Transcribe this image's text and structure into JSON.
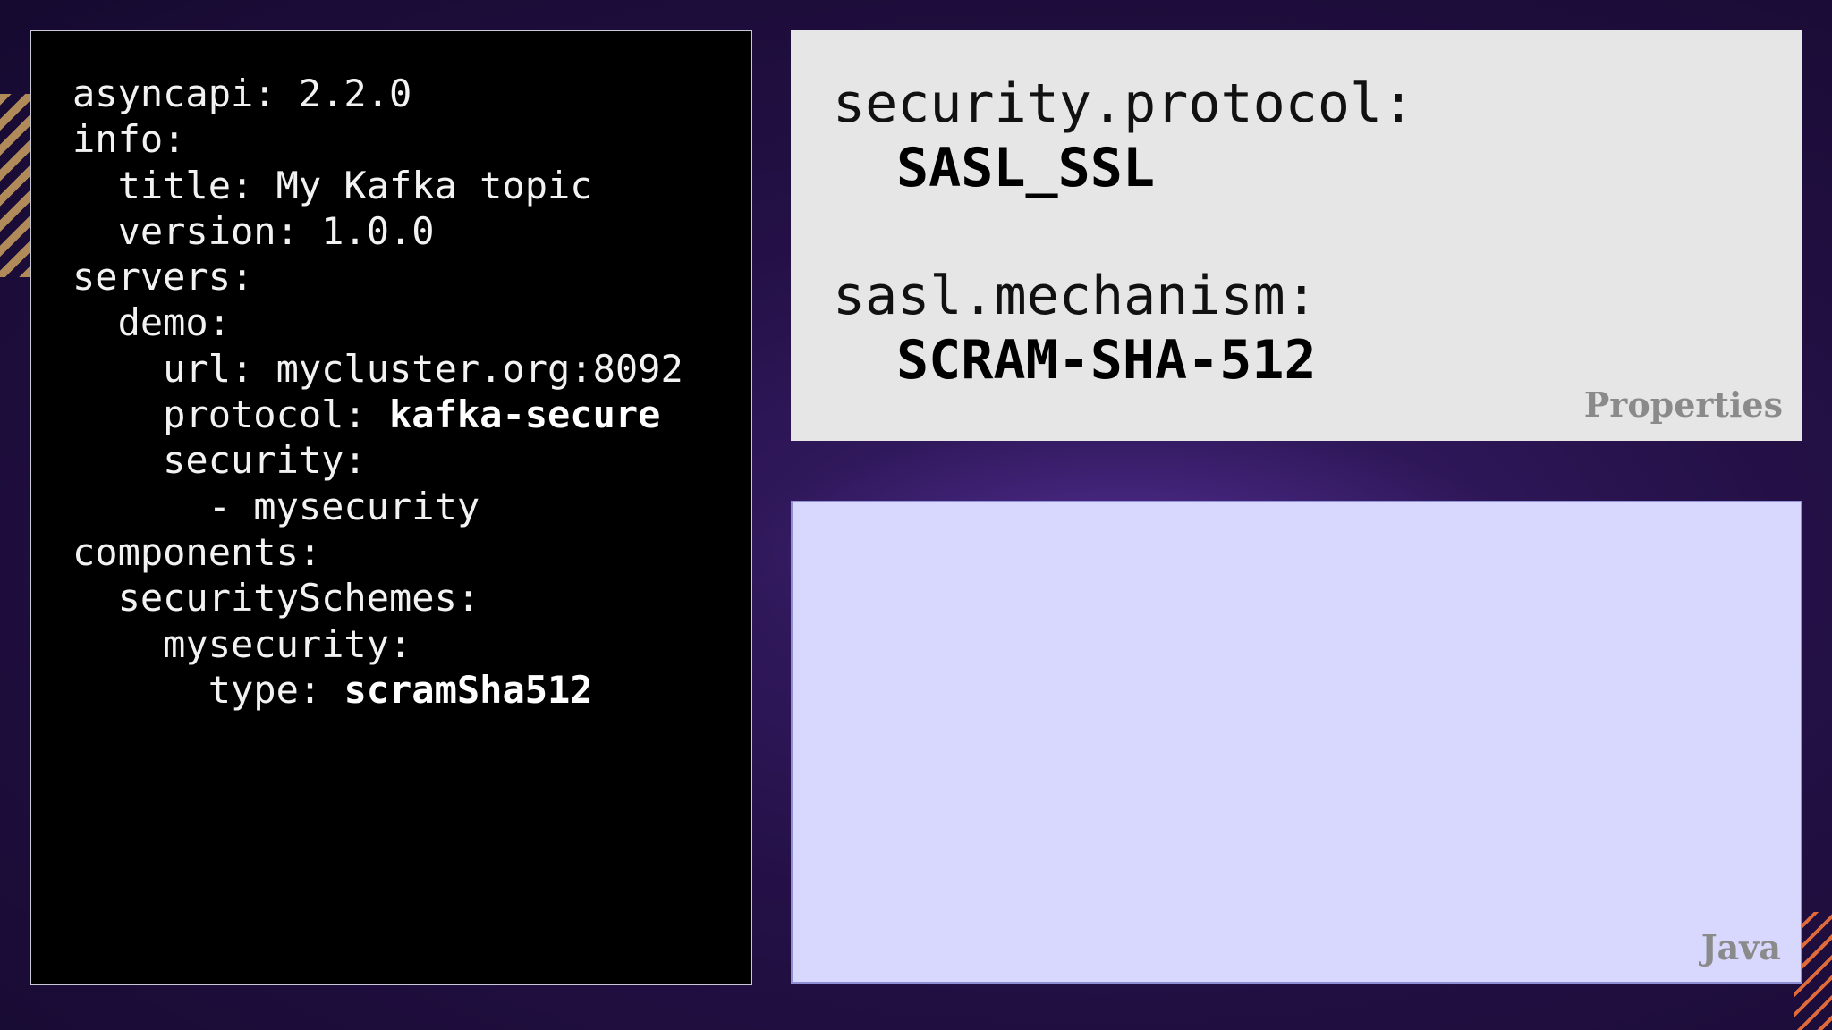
{
  "yaml": {
    "lines": [
      {
        "pre": "asyncapi: 2.2.0",
        "bold": ""
      },
      {
        "pre": "info:",
        "bold": ""
      },
      {
        "pre": "  title: My Kafka topic",
        "bold": ""
      },
      {
        "pre": "  version: 1.0.0",
        "bold": ""
      },
      {
        "pre": "servers:",
        "bold": ""
      },
      {
        "pre": "  demo:",
        "bold": ""
      },
      {
        "pre": "    url: mycluster.org:8092",
        "bold": ""
      },
      {
        "pre": "    protocol: ",
        "bold": "kafka-secure"
      },
      {
        "pre": "    security:",
        "bold": ""
      },
      {
        "pre": "      - mysecurity",
        "bold": ""
      },
      {
        "pre": "components:",
        "bold": ""
      },
      {
        "pre": "  securitySchemes:",
        "bold": ""
      },
      {
        "pre": "    mysecurity:",
        "bold": ""
      },
      {
        "pre": "      type: ",
        "bold": "scramSha512"
      }
    ]
  },
  "properties": {
    "entries": [
      {
        "key": "security.protocol:",
        "value": "SASL_SSL"
      },
      {
        "key": "sasl.mechanism:",
        "value": "SCRAM-SHA-512"
      }
    ],
    "tag": "Properties"
  },
  "java": {
    "tag": "Java"
  }
}
